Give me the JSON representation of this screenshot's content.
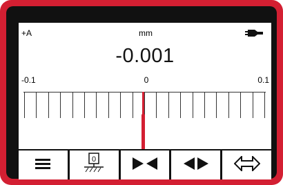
{
  "status": {
    "mode": "+A",
    "unit": "mm"
  },
  "display": {
    "reading": "-0.001"
  },
  "scale": {
    "min_label": "-0.1",
    "mid_label": "0",
    "max_label": "0.1"
  },
  "needle": {
    "value": -0.001
  },
  "softkeys": [
    {
      "name": "menu-icon"
    },
    {
      "name": "zero-reference-icon",
      "label": "0"
    },
    {
      "name": "tolerance-in-icon"
    },
    {
      "name": "tolerance-out-icon"
    },
    {
      "name": "transfer-arrow-icon"
    }
  ],
  "colors": {
    "accent": "#d31f32",
    "bezel": "#111111",
    "screen": "#ffffff"
  }
}
